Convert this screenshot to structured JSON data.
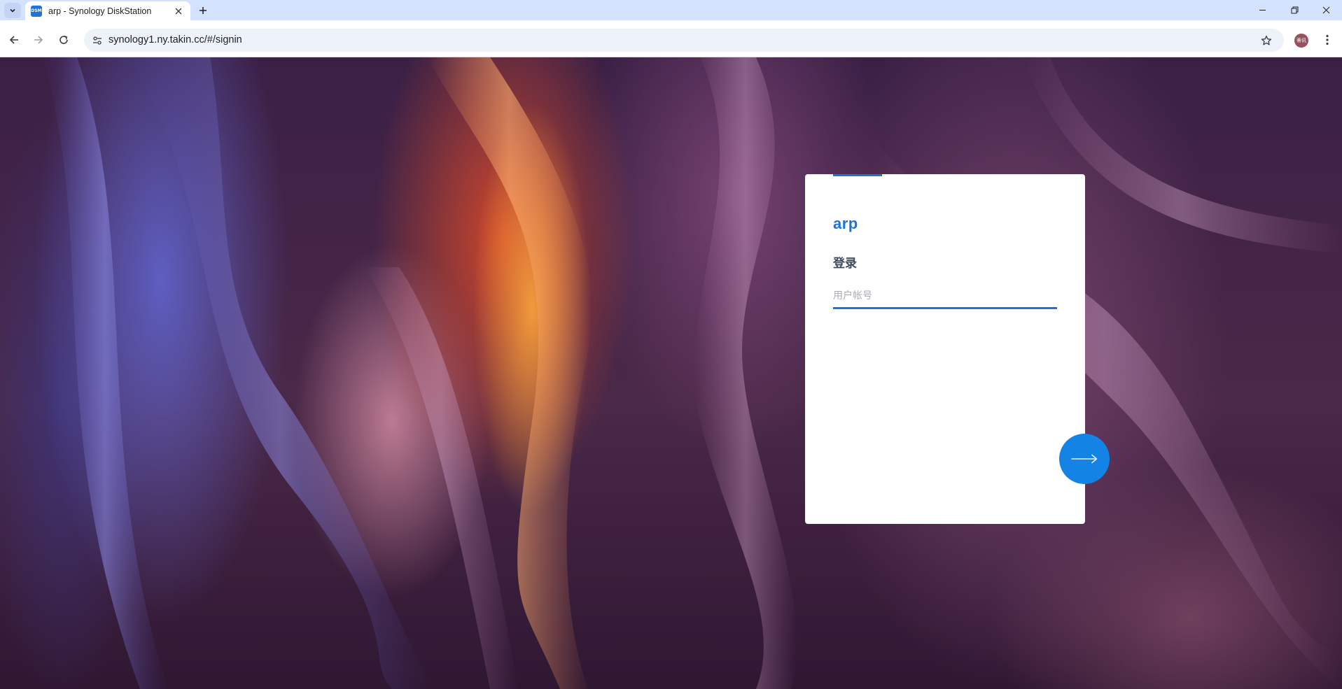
{
  "browser": {
    "tab_title": "arp - Synology DiskStation",
    "favicon_text": "DSM",
    "url": "synology1.ny.takin.cc/#/signin",
    "profile_initials": "蒂讯",
    "colors": {
      "tabstrip": "#d3e3fd",
      "omnibox": "#eef3fb"
    }
  },
  "login": {
    "server_name": "arp",
    "title": "登录",
    "username_placeholder": "用户帐号",
    "next_icon": "arrow-right-icon",
    "colors": {
      "accent": "#1e73d9",
      "button": "#1483e6"
    }
  }
}
